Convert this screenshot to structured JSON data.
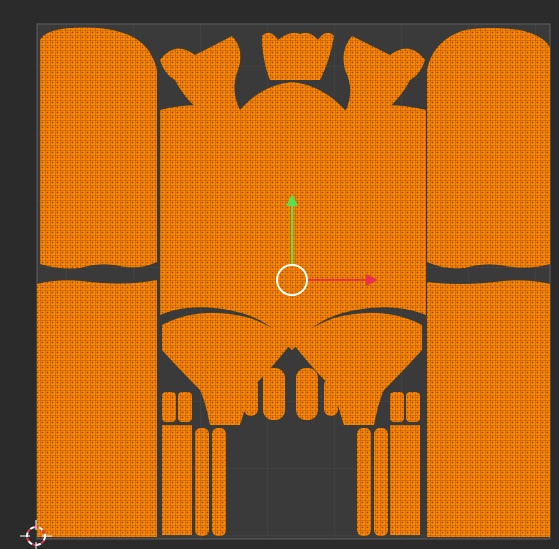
{
  "editor": "uv-editor-viewport",
  "colors": {
    "background": "#2b2b2b",
    "uv_area": "#3a3a3a",
    "grid": "#454545",
    "border": "#5b5b5b",
    "selected": "#ff8600",
    "wire": "#2a1a08",
    "gizmo_y": "#59e04f",
    "gizmo_x": "#e8324c",
    "gizmo_ring": "#ffffff"
  },
  "islands": [
    "sleeve-left-upper",
    "sleeve-right-upper",
    "sleeve-left-lower",
    "sleeve-right-lower",
    "collar-left",
    "collar-center",
    "collar-right",
    "chest-front",
    "cuff-left",
    "cuff-right",
    "trouser-left",
    "trouser-right",
    "tab-strips-left",
    "tab-strips-right",
    "small-tabs-center"
  ],
  "gizmo": {
    "axes": [
      "y-axis",
      "x-axis"
    ],
    "center": "transform-center-ring"
  },
  "cursor": {
    "icon": "3d-cursor-icon"
  }
}
